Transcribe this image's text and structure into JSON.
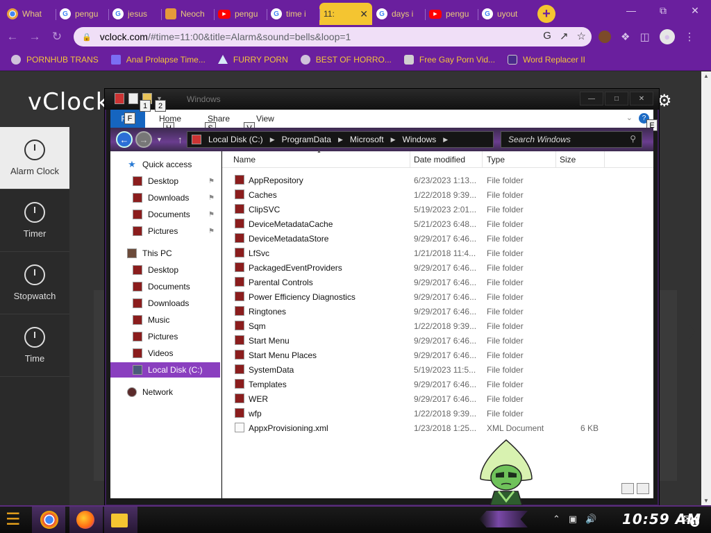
{
  "browser": {
    "tabs": [
      {
        "label": "What",
        "icon": "chrome-icon",
        "kind": "chrome"
      },
      {
        "label": "pengu",
        "icon": "google-icon",
        "kind": "g"
      },
      {
        "label": "jesus",
        "icon": "google-icon",
        "kind": "g"
      },
      {
        "label": "Neoch",
        "icon": "cat-icon",
        "kind": "cat"
      },
      {
        "label": "pengu",
        "icon": "youtube-icon",
        "kind": "yt"
      },
      {
        "label": "time i",
        "icon": "google-icon",
        "kind": "g"
      },
      {
        "label": "11:",
        "icon": "clock-icon",
        "kind": "clock",
        "active": true
      },
      {
        "label": "days i",
        "icon": "google-icon",
        "kind": "g"
      },
      {
        "label": "pengu",
        "icon": "youtube-icon",
        "kind": "yt"
      },
      {
        "label": "uyout",
        "icon": "google-icon",
        "kind": "g"
      }
    ],
    "new_tab": "+",
    "url_host": "vclock.com",
    "url_rest": "/#time=11:00&title=Alarm&sound=bells&loop=1",
    "bookmarks": [
      {
        "label": "PORNHUB TRANS",
        "icon": "globe-icon"
      },
      {
        "label": "Anal Prolapse Time...",
        "icon": "bookmark-icon"
      },
      {
        "label": "FURRY PORN",
        "icon": "triangle-icon"
      },
      {
        "label": "BEST OF HORRO...",
        "icon": "globe-icon"
      },
      {
        "label": "Free Gay Porn Vid...",
        "icon": "bot-icon"
      },
      {
        "label": "Word Replacer II",
        "icon": "wr-icon"
      }
    ]
  },
  "vclock": {
    "logo": "vClock",
    "nav": [
      {
        "label": "Alarm Clock",
        "active": true
      },
      {
        "label": "Timer"
      },
      {
        "label": "Stopwatch"
      },
      {
        "label": "Time"
      }
    ]
  },
  "explorer": {
    "window_title": "Windows",
    "ribbon_tabs": {
      "file": "File",
      "home": "Home",
      "share": "Share",
      "view": "View"
    },
    "key_badges": {
      "file": "F",
      "qa1": "1",
      "qa2": "2",
      "home": "H",
      "share": "S",
      "view": "V",
      "help": "E"
    },
    "breadcrumb": [
      "Local Disk (C:)",
      "ProgramData",
      "Microsoft",
      "Windows"
    ],
    "search_placeholder": "Search Windows",
    "nav": [
      {
        "label": "Quick access",
        "kind": "star",
        "y": 0
      },
      {
        "label": "Desktop",
        "pinned": true
      },
      {
        "label": "Downloads",
        "pinned": true
      },
      {
        "label": "Documents",
        "pinned": true
      },
      {
        "label": "Pictures",
        "pinned": true
      },
      {
        "label": "This PC",
        "kind": "pc"
      },
      {
        "label": "Desktop"
      },
      {
        "label": "Documents"
      },
      {
        "label": "Downloads"
      },
      {
        "label": "Music"
      },
      {
        "label": "Pictures"
      },
      {
        "label": "Videos"
      },
      {
        "label": "Local Disk (C:)",
        "selected": true
      },
      {
        "label": "Network",
        "kind": "net"
      }
    ],
    "columns": {
      "name": "Name",
      "date": "Date modified",
      "type": "Type",
      "size": "Size"
    },
    "files": [
      {
        "name": "AppRepository",
        "date": "6/23/2023 1:13...",
        "type": "File folder",
        "size": ""
      },
      {
        "name": "Caches",
        "date": "1/22/2018 9:39...",
        "type": "File folder",
        "size": ""
      },
      {
        "name": "ClipSVC",
        "date": "5/19/2023 2:01...",
        "type": "File folder",
        "size": ""
      },
      {
        "name": "DeviceMetadataCache",
        "date": "5/21/2023 6:48...",
        "type": "File folder",
        "size": ""
      },
      {
        "name": "DeviceMetadataStore",
        "date": "9/29/2017 6:46...",
        "type": "File folder",
        "size": ""
      },
      {
        "name": "LfSvc",
        "date": "1/21/2018 11:4...",
        "type": "File folder",
        "size": ""
      },
      {
        "name": "PackagedEventProviders",
        "date": "9/29/2017 6:46...",
        "type": "File folder",
        "size": ""
      },
      {
        "name": "Parental Controls",
        "date": "9/29/2017 6:46...",
        "type": "File folder",
        "size": ""
      },
      {
        "name": "Power Efficiency Diagnostics",
        "date": "9/29/2017 6:46...",
        "type": "File folder",
        "size": ""
      },
      {
        "name": "Ringtones",
        "date": "9/29/2017 6:46...",
        "type": "File folder",
        "size": ""
      },
      {
        "name": "Sqm",
        "date": "1/22/2018 9:39...",
        "type": "File folder",
        "size": ""
      },
      {
        "name": "Start Menu",
        "date": "9/29/2017 6:46...",
        "type": "File folder",
        "size": ""
      },
      {
        "name": "Start Menu Places",
        "date": "9/29/2017 6:46...",
        "type": "File folder",
        "size": ""
      },
      {
        "name": "SystemData",
        "date": "5/19/2023 11:5...",
        "type": "File folder",
        "size": ""
      },
      {
        "name": "Templates",
        "date": "9/29/2017 6:46...",
        "type": "File folder",
        "size": ""
      },
      {
        "name": "WER",
        "date": "9/29/2017 6:46...",
        "type": "File folder",
        "size": ""
      },
      {
        "name": "wfp",
        "date": "1/22/2018 9:39...",
        "type": "File folder",
        "size": ""
      },
      {
        "name": "AppxProvisioning.xml",
        "date": "1/23/2018 1:25...",
        "type": "XML Document",
        "size": "6 KB",
        "xml": true
      }
    ]
  },
  "taskbar": {
    "clock": "10:59 AM",
    "notifications": "1"
  }
}
